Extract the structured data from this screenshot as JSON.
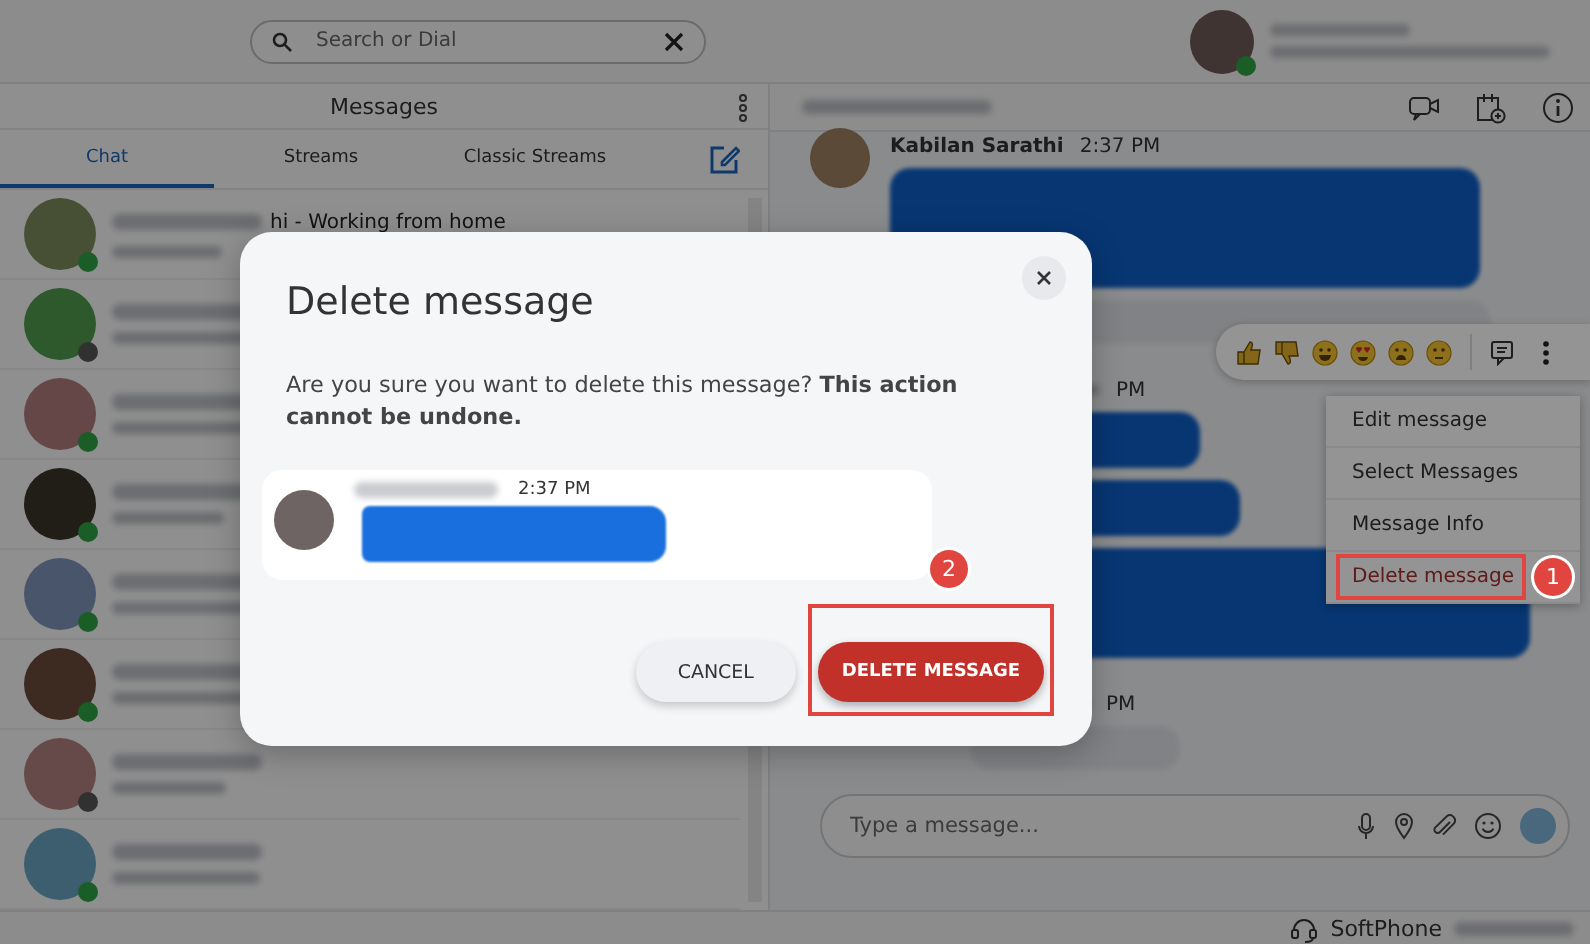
{
  "top_bar": {
    "search": {
      "placeholder": "Search or Dial"
    },
    "user": {
      "online": true
    }
  },
  "messages_panel": {
    "title": "Messages",
    "tabs": [
      {
        "label": "Chat",
        "selected": true
      },
      {
        "label": "Streams",
        "selected": false
      },
      {
        "label": "Classic Streams",
        "selected": false
      }
    ],
    "conversations": [
      {
        "preview": "hi - Working from home",
        "online": true
      },
      {
        "online": false
      },
      {
        "online": true
      },
      {
        "online": true
      },
      {
        "online": true
      },
      {
        "online": true
      },
      {
        "online": false
      },
      {
        "online": true
      }
    ]
  },
  "chat": {
    "messages": [
      {
        "sender": "Kabilan Sarathi",
        "time": "2:37 PM",
        "bubbles": [
          {
            "kind": "highlighted"
          },
          {
            "kind": "plain"
          }
        ]
      },
      {
        "time": "PM",
        "bubbles": [
          {
            "kind": "highlighted"
          },
          {
            "kind": "highlighted"
          },
          {
            "kind": "highlighted"
          }
        ]
      },
      {
        "time": "PM",
        "bubbles": [
          {
            "kind": "plain"
          }
        ]
      }
    ],
    "context_menu": [
      {
        "label": "Edit message",
        "kind": "normal"
      },
      {
        "label": "Select Messages",
        "kind": "normal"
      },
      {
        "label": "Message Info",
        "kind": "normal"
      },
      {
        "label": "Delete message",
        "kind": "danger"
      }
    ],
    "compose": {
      "placeholder": "Type a message..."
    }
  },
  "status_bar": {
    "softphone": "SoftPhone"
  },
  "dialog": {
    "title": "Delete message",
    "body": "Are you sure you want to delete this message? **This action cannot be undone.**",
    "preview": {
      "time": "2:37 PM"
    },
    "buttons": [
      {
        "label": "CANCEL",
        "kind": "secondary"
      },
      {
        "label": "DELETE MESSAGE",
        "kind": "primary"
      }
    ]
  },
  "annotations": [
    {
      "label": "1"
    },
    {
      "label": "2"
    }
  ]
}
